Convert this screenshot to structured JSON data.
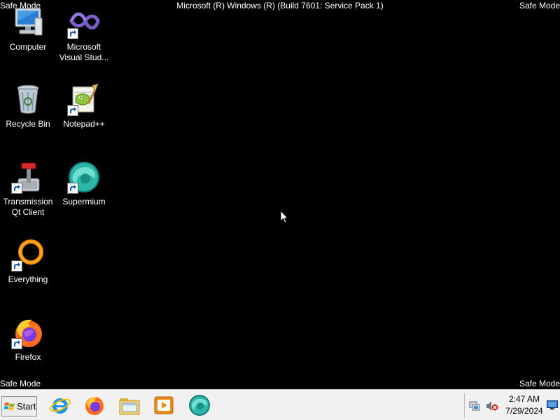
{
  "overlay": {
    "safe_mode_top_left": "Safe Mode",
    "safe_mode_top_right": "Safe Mode",
    "safe_mode_bottom_left": "Safe Mode",
    "safe_mode_bottom_right": "Safe Mode",
    "build_text": "Microsoft (R) Windows (R) (Build 7601: Service Pack 1)"
  },
  "desktop_icons": {
    "computer": "Computer",
    "visual_studio_line1": "Microsoft",
    "visual_studio_line2": "Visual Stud...",
    "recycle_bin": "Recycle Bin",
    "notepad_pp": "Notepad++",
    "transmission_line1": "Transmission",
    "transmission_line2": "Qt Client",
    "supermium": "Supermium",
    "everything": "Everything",
    "firefox": "Firefox"
  },
  "taskbar": {
    "start_label": "Start",
    "pinned": [
      "internet-explorer-icon",
      "firefox-icon",
      "file-explorer-icon",
      "media-player-icon",
      "supermium-icon"
    ]
  },
  "tray": {
    "time": "2:47 AM",
    "date": "7/29/2024"
  },
  "colors": {
    "desktop_background": "#000000",
    "taskbar_background": "#f1f1f1"
  }
}
